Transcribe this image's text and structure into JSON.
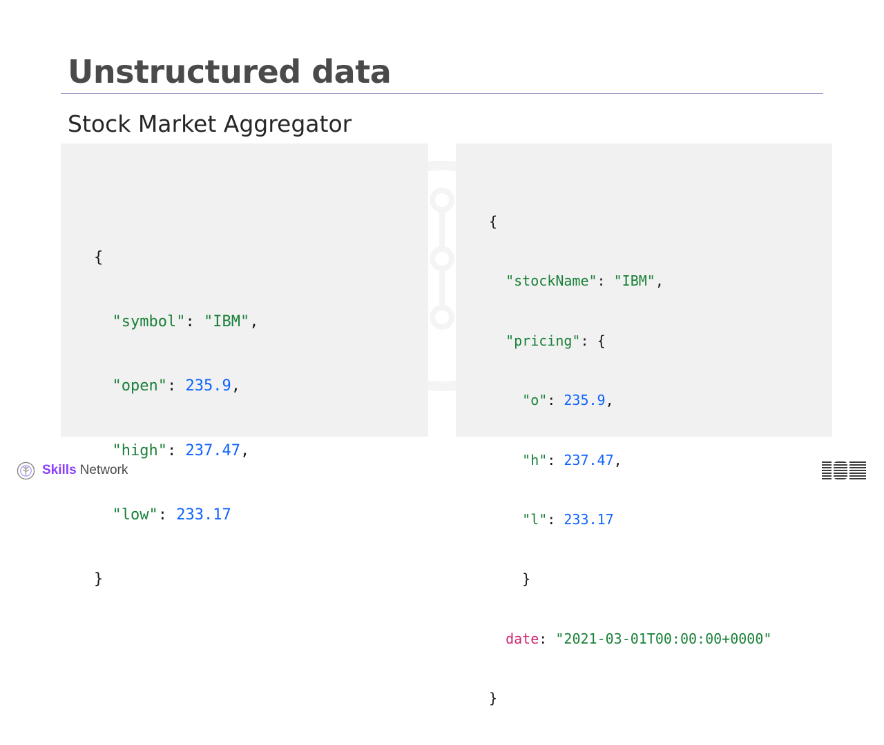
{
  "slide": {
    "title": "Unstructured data",
    "subtitle": "Stock Market Aggregator"
  },
  "left_code": {
    "open_brace": "{",
    "close_brace": "}",
    "lines": [
      {
        "key": "\"symbol\"",
        "sep": ": ",
        "value": "\"IBM\"",
        "value_type": "string",
        "trail": ","
      },
      {
        "key": "\"open\"",
        "sep": ": ",
        "value": "235.9",
        "value_type": "number",
        "trail": ","
      },
      {
        "key": "\"high\"",
        "sep": ": ",
        "value": "237.47",
        "value_type": "number",
        "trail": ","
      },
      {
        "key": "\"low\"",
        "sep": ": ",
        "value": "233.17",
        "value_type": "number",
        "trail": ""
      }
    ]
  },
  "right_code": {
    "open_brace": "{",
    "close_brace": "}",
    "stock_key": "\"stockName\"",
    "stock_value": "\"IBM\"",
    "pricing_key": "\"pricing\"",
    "pricing_open": "{",
    "pricing_close": "}",
    "pricing_lines": [
      {
        "key": "\"o\"",
        "value": "235.9",
        "trail": ","
      },
      {
        "key": "\"h\"",
        "value": "237.47",
        "trail": ","
      },
      {
        "key": "\"l\"",
        "value": "233.17",
        "trail": ""
      }
    ],
    "date_key": "date",
    "date_value": "\"2021-03-01T00:00:00+0000\""
  },
  "footer": {
    "brand_bold": "Skills",
    "brand_rest": "Network",
    "logo_icon": "skills-network-icon",
    "corporate_logo": "IBM"
  },
  "colors": {
    "key": "#198038",
    "number": "#0f62fe",
    "field": "#d02670",
    "brand": "#8a3ffc",
    "panel": "#f1f1f1",
    "title": "#4a4a4a"
  }
}
